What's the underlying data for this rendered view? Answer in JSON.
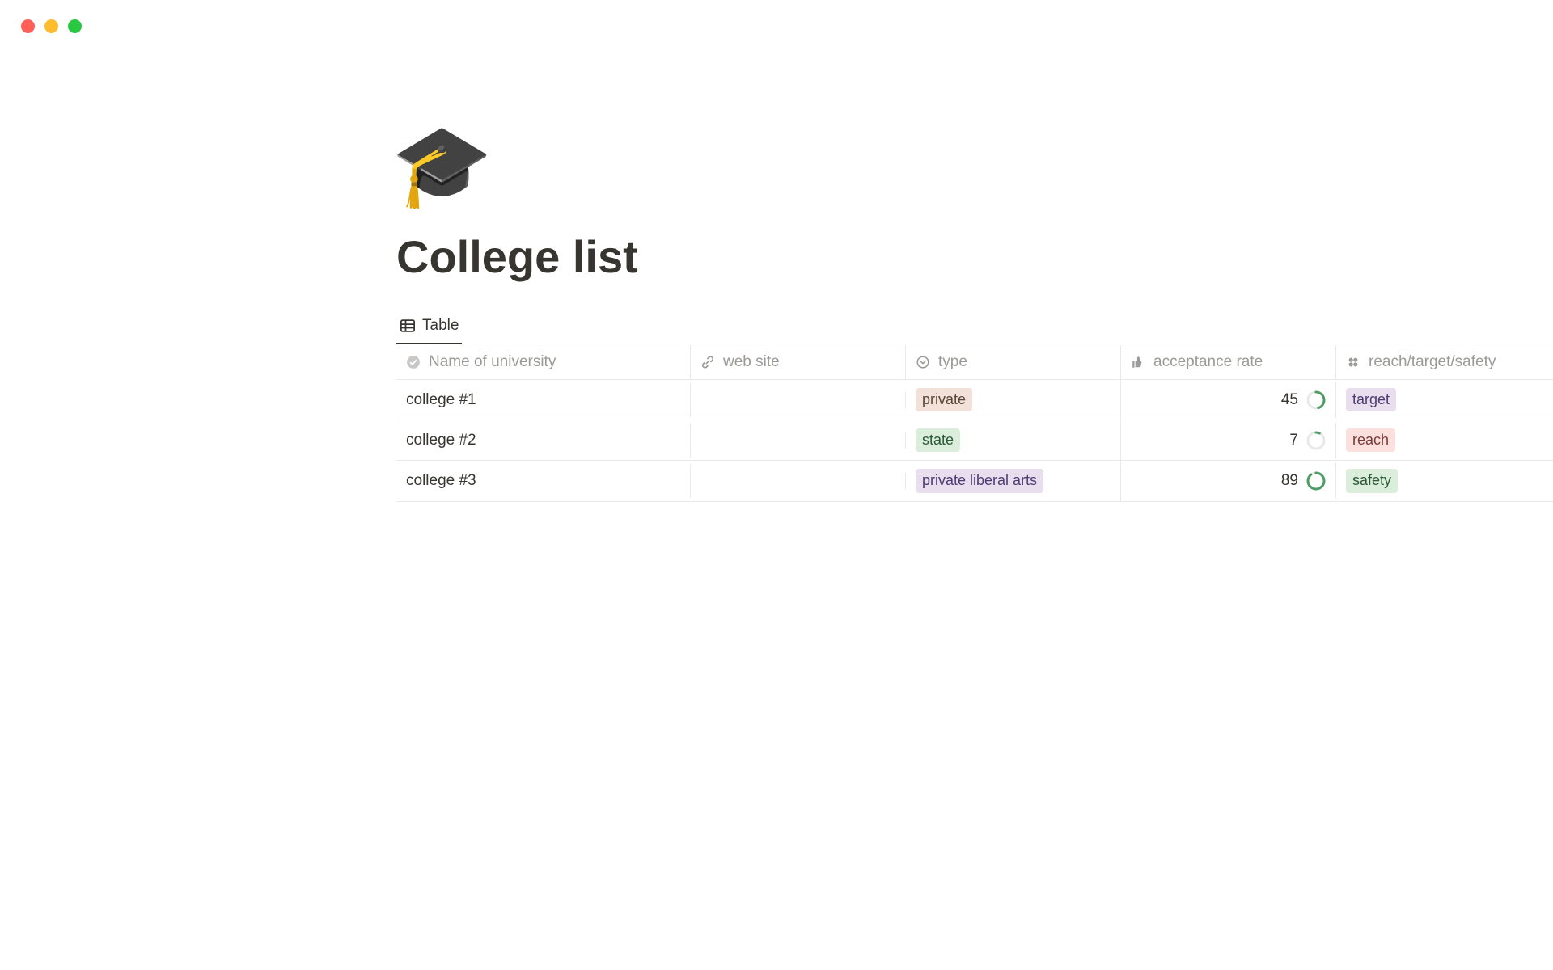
{
  "page": {
    "icon": "🎓",
    "title": "College list"
  },
  "tabs": {
    "active": "Table"
  },
  "columns": {
    "name": "Name of university",
    "web": "web site",
    "type": "type",
    "rate": "acceptance rate",
    "rts": "reach/target/safety"
  },
  "rows": [
    {
      "name": "college #1",
      "web": "",
      "type": {
        "label": "private",
        "color": "brown"
      },
      "rate": 45,
      "rts": {
        "label": "target",
        "color": "purple"
      }
    },
    {
      "name": "college #2",
      "web": "",
      "type": {
        "label": "state",
        "color": "green"
      },
      "rate": 7,
      "rts": {
        "label": "reach",
        "color": "red"
      }
    },
    {
      "name": "college #3",
      "web": "",
      "type": {
        "label": "private liberal arts",
        "color": "purple"
      },
      "rate": 89,
      "rts": {
        "label": "safety",
        "color": "green2"
      }
    }
  ]
}
